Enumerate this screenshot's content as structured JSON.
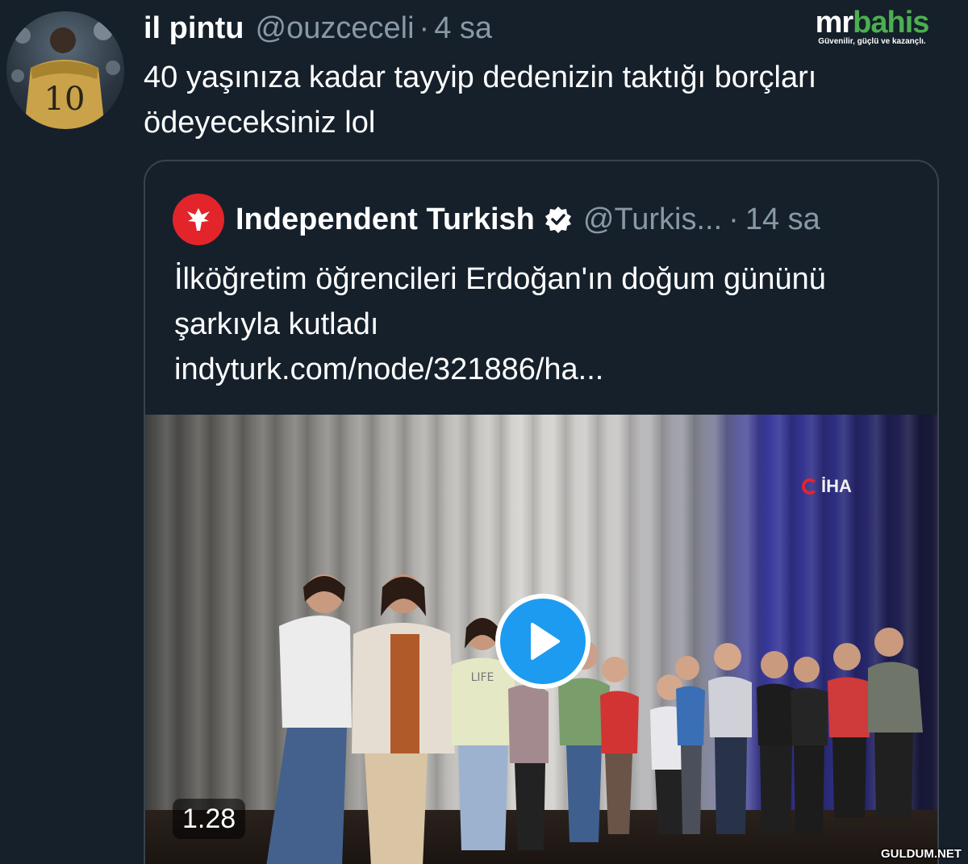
{
  "tweet": {
    "author_name": "il pintu",
    "author_handle": "@ouzceceli",
    "separator": "·",
    "timestamp": "4 sa",
    "text": "40 yaşınıza kadar tayyip dedenizin taktığı borçları ödeyeceksiniz lol"
  },
  "brand_logo": {
    "name_part1": "mr",
    "name_part2": "bahis",
    "slogan": "Güvenilir, güçlü ve kazançlı."
  },
  "quoted_tweet": {
    "author_name": "Independent Turkish",
    "author_handle": "@Turkis...",
    "separator": "·",
    "timestamp": "14 sa",
    "text": "İlköğretim öğrencileri Erdoğan'ın doğum gününü şarkıyla kutladı",
    "link": "indyturk.com/node/321886/ha..."
  },
  "video": {
    "duration": "1.28",
    "channel_logo": "İHA",
    "shirt_text": "LIFE"
  },
  "watermark": "GULDUM.NET",
  "icons": {
    "verified": "verified-badge-icon",
    "play": "play-icon",
    "publisher": "independent-eagle-icon"
  },
  "colors": {
    "background": "#15202b",
    "secondary_text": "#8899a6",
    "card_border": "#38444d",
    "accent_blue": "#1d9bf0",
    "independent_red": "#e3242b",
    "brand_green": "#4caf50"
  }
}
